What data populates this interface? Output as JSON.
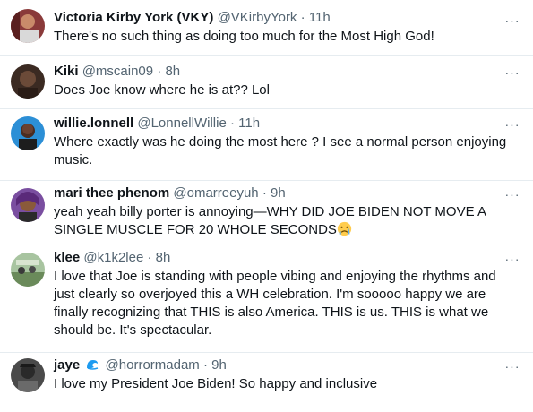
{
  "tweets": [
    {
      "name": "Victoria Kirby York (VKY)",
      "handle": "@VKirbyYork",
      "dot": "·",
      "time": "11h",
      "text": "There's no such thing as doing too much for the Most High God!",
      "more": "···"
    },
    {
      "name": "Kiki",
      "handle": "@mscain09",
      "dot": "·",
      "time": "8h",
      "text": "Does Joe know where he is at?? Lol",
      "more": "···"
    },
    {
      "name": "willie.lonnell",
      "handle": "@LonnellWillie",
      "dot": "·",
      "time": "11h",
      "text": "Where exactly was he doing the most here ? I see a normal person enjoying music.",
      "more": "···"
    },
    {
      "name": "mari thee phenom",
      "handle": "@omarreeyuh",
      "dot": "·",
      "time": "9h",
      "text": "yeah yeah billy porter is annoying—WHY DID JOE BIDEN NOT MOVE A SINGLE MUSCLE FOR 20 WHOLE SECONDS",
      "emoji": "crying-face",
      "more": "···"
    },
    {
      "name": "klee",
      "handle": "@k1k2lee",
      "dot": "·",
      "time": "8h",
      "text": "I love that Joe is standing with people vibing and enjoying the rhythms and just clearly so overjoyed this a WH celebration. I'm sooooo happy we are finally recognizing that THIS is also America. THIS is us. THIS is what we should be.  It's spectacular.",
      "more": "···"
    },
    {
      "name": "jaye",
      "handle": "@horrormadam",
      "dot": "·",
      "time": "9h",
      "text": "I love my President Joe Biden! So happy and inclusive",
      "badge_icon": "wave-icon",
      "more": "···"
    }
  ],
  "colors": {
    "text": "#0f1419",
    "secondary": "#536471",
    "divider": "#e6ecf0",
    "badge": "#1d9bf0"
  }
}
